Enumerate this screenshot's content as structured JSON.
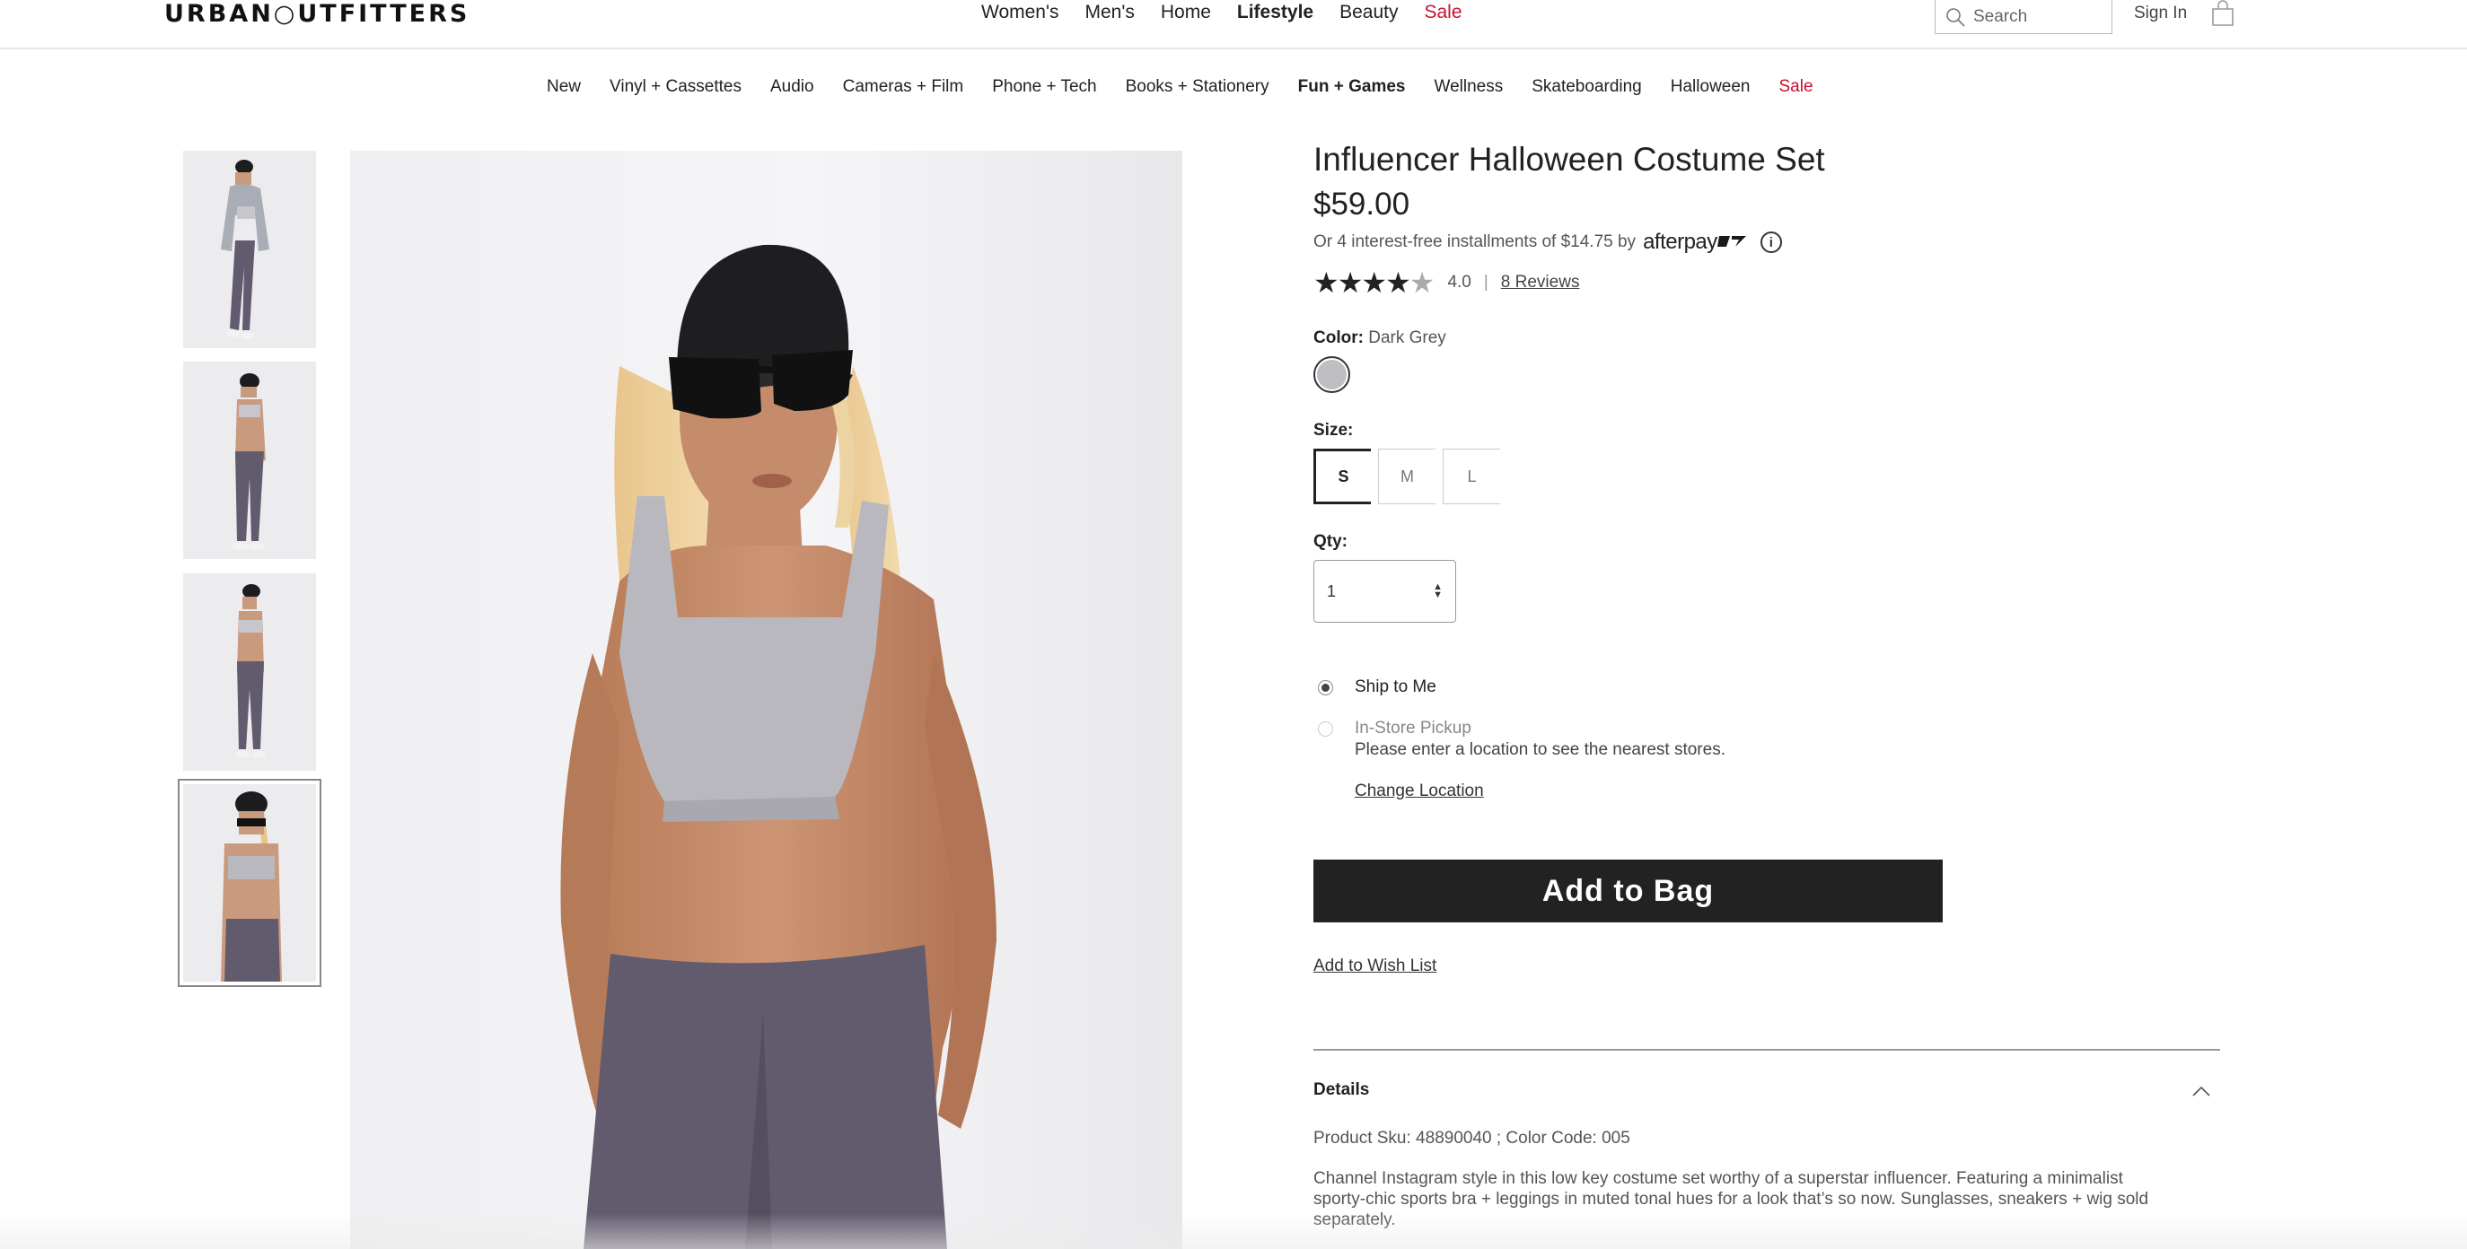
{
  "header": {
    "logo": "URBAN○UTFITTERS",
    "nav": [
      {
        "label": "Women's",
        "style": "normal"
      },
      {
        "label": "Men's",
        "style": "normal"
      },
      {
        "label": "Home",
        "style": "normal"
      },
      {
        "label": "Lifestyle",
        "style": "bold"
      },
      {
        "label": "Beauty",
        "style": "normal"
      },
      {
        "label": "Sale",
        "style": "sale"
      }
    ],
    "search_placeholder": "Search",
    "sign_in": "Sign In"
  },
  "subnav": [
    {
      "label": "New",
      "style": "normal"
    },
    {
      "label": "Vinyl + Cassettes",
      "style": "normal"
    },
    {
      "label": "Audio",
      "style": "normal"
    },
    {
      "label": "Cameras + Film",
      "style": "normal"
    },
    {
      "label": "Phone + Tech",
      "style": "normal"
    },
    {
      "label": "Books + Stationery",
      "style": "normal"
    },
    {
      "label": "Fun + Games",
      "style": "bold"
    },
    {
      "label": "Wellness",
      "style": "normal"
    },
    {
      "label": "Skateboarding",
      "style": "normal"
    },
    {
      "label": "Halloween",
      "style": "normal"
    },
    {
      "label": "Sale",
      "style": "sale"
    }
  ],
  "gallery": {
    "thumbnail_count": 4,
    "active_index": 3
  },
  "product": {
    "title": "Influencer Halloween Costume Set",
    "price": "$59.00",
    "afterpay_text": "Or 4 interest-free installments of $14.75 by",
    "afterpay_logo": "afterpay",
    "rating_value": "4.0",
    "rating_stars": 4,
    "rating_sep": "|",
    "reviews_link": "8 Reviews",
    "color_label": "Color:",
    "color_value": "Dark Grey",
    "swatch_color": "#bfbfc3",
    "size_label": "Size:",
    "sizes": [
      "S",
      "M",
      "L"
    ],
    "selected_size": "S",
    "qty_label": "Qty:",
    "qty_value": "1",
    "ship_to_me": "Ship to Me",
    "in_store_pickup": "In-Store Pickup",
    "pickup_note": "Please enter a location to see the nearest stores.",
    "change_location": "Change Location",
    "add_to_bag": "Add to Bag",
    "add_to_wishlist": "Add to Wish List"
  },
  "details": {
    "header": "Details",
    "sku": "Product Sku: 48890040 ; Color Code: 005",
    "description": "Channel Instagram style in this low key costume set worthy of a superstar influencer. Featuring a minimalist sporty-chic sports bra + leggings in muted tonal hues for a look that’s so now. Sunglasses, sneakers + wig sold separately."
  },
  "colors": {
    "sale": "#c8102e",
    "button_bg": "#222222",
    "leggings": "#625b6e",
    "top": "#b9b8bf"
  }
}
